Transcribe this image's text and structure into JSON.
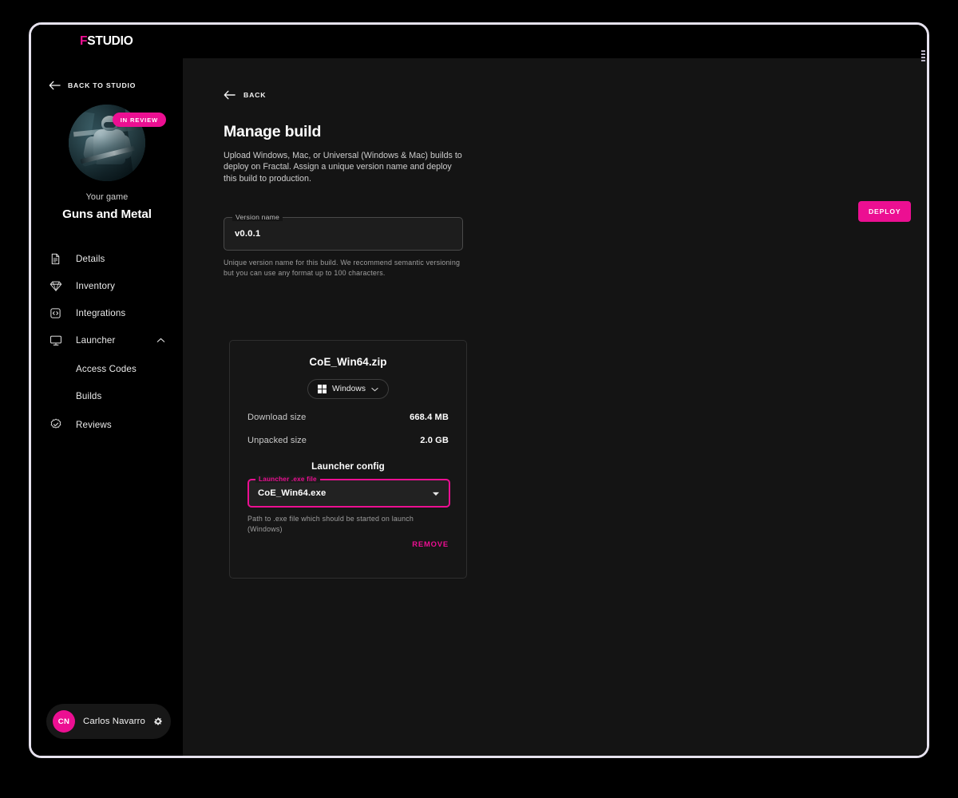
{
  "brand": {
    "accent_letter": "F",
    "rest": "STUDIO"
  },
  "colors": {
    "accent": "#ec0f92",
    "panel": "#141414",
    "sidebar": "#000000",
    "card": "#161616"
  },
  "sidebar": {
    "back_to_studio": "BACK TO STUDIO",
    "status_badge": "IN REVIEW",
    "your_game_label": "Your game",
    "game_title": "Guns and Metal",
    "items": [
      {
        "label": "Details",
        "icon": "document-icon"
      },
      {
        "label": "Inventory",
        "icon": "gem-icon"
      },
      {
        "label": "Integrations",
        "icon": "code-box-icon"
      },
      {
        "label": "Launcher",
        "icon": "monitor-icon"
      },
      {
        "label": "Reviews",
        "icon": "check-badge-icon"
      }
    ],
    "launcher_children": [
      {
        "label": "Access Codes"
      },
      {
        "label": "Builds"
      }
    ],
    "user": {
      "initials": "CN",
      "name": "Carlos Navarro",
      "settings_icon": "gear-icon"
    }
  },
  "main": {
    "back_label": "BACK",
    "title": "Manage build",
    "description": "Upload Windows, Mac, or Universal (Windows & Mac) builds to deploy on Fractal. Assign a unique version name and deploy this build to production.",
    "deploy_label": "DEPLOY",
    "version_field": {
      "legend": "Version name",
      "value": "v0.0.1",
      "helper": "Unique version name for this build. We recommend semantic versioning but you can use any format up to 100 characters."
    },
    "build_card": {
      "filename": "CoE_Win64.zip",
      "platform": "Windows",
      "platform_icon": "windows-logo-icon",
      "rows": [
        {
          "key": "Download size",
          "value": "668.4 MB"
        },
        {
          "key": "Unpacked size",
          "value": "2.0 GB"
        }
      ],
      "launcher_config_title": "Launcher config",
      "exe_field": {
        "legend": "Launcher .exe file",
        "value": "CoE_Win64.exe",
        "helper": "Path to .exe file which should be started on launch (Windows)"
      },
      "remove_label": "REMOVE"
    }
  }
}
